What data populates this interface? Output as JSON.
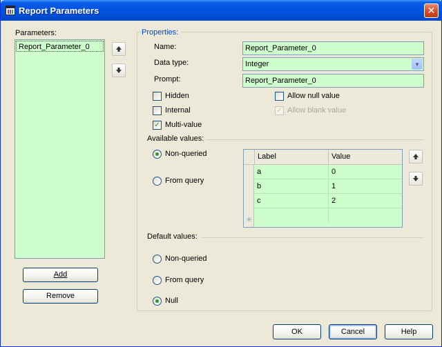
{
  "window": {
    "title": "Report Parameters",
    "close_glyph": "✕"
  },
  "parameters": {
    "label": "Parameters:",
    "items": [
      "Report_Parameter_0"
    ],
    "add_label": "Add",
    "remove_label": "Remove",
    "move_up_icon": "up-arrow-icon",
    "move_down_icon": "down-arrow-icon"
  },
  "properties": {
    "group_label": "Properties:",
    "name_label": "Name:",
    "name_value": "Report_Parameter_0",
    "datatype_label": "Data type:",
    "datatype_value": "Integer",
    "prompt_label": "Prompt:",
    "prompt_value": "Report_Parameter_0",
    "hidden_label": "Hidden",
    "hidden_checked": false,
    "internal_label": "Internal",
    "internal_checked": false,
    "multivalue_label": "Multi-value",
    "multivalue_checked": true,
    "allow_null_label": "Allow null value",
    "allow_null_checked": false,
    "allow_blank_label": "Allow blank value",
    "allow_blank_checked": true,
    "allow_blank_disabled": true
  },
  "available_values": {
    "label": "Available values:",
    "non_queried_label": "Non-queried",
    "from_query_label": "From query",
    "selected": "non_queried",
    "grid": {
      "columns": [
        "Label",
        "Value"
      ],
      "rows": [
        {
          "label": "a",
          "value": "0"
        },
        {
          "label": "b",
          "value": "1"
        },
        {
          "label": "c",
          "value": "2"
        }
      ],
      "new_row_glyph": "✳"
    }
  },
  "default_values": {
    "label": "Default values:",
    "non_queried_label": "Non-queried",
    "from_query_label": "From query",
    "null_label": "Null",
    "selected": "null"
  },
  "footer": {
    "ok_label": "OK",
    "cancel_label": "Cancel",
    "help_label": "Help"
  },
  "colors": {
    "title_bar": "#0054e3",
    "field_bg": "#cdfecb",
    "dialog_bg": "#ece9d8",
    "group_label": "#0046d5"
  }
}
